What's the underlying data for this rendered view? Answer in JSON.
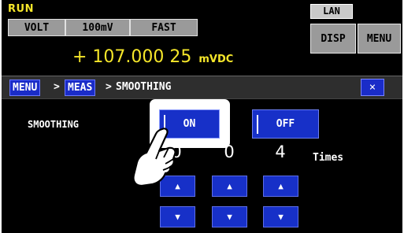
{
  "status": {
    "run": "RUN",
    "lan": "LAN"
  },
  "tabs": {
    "function": "VOLT",
    "range": "100mV",
    "speed": "FAST"
  },
  "side_buttons": {
    "disp": "DISP",
    "menu": "MENU"
  },
  "reading": {
    "value": "+ 107.000 25",
    "unit": "mVDC"
  },
  "breadcrumb": {
    "menu": "MENU",
    "meas": "MEAS",
    "page": "SMOOTHING",
    "sep": ">",
    "close": "×"
  },
  "smoothing": {
    "label": "SMOOTHING",
    "on_label": "ON",
    "off_label": "OFF",
    "selected": "ON",
    "digits": [
      "0",
      "0",
      "4"
    ],
    "unit": "Times"
  },
  "arrows": {
    "up": "▲",
    "down": "▼"
  },
  "icons": {
    "hand": "pointing-hand-icon",
    "close": "close-icon"
  },
  "colors": {
    "accent_yellow": "#f5e62a",
    "button_blue": "#1730c8",
    "gray": "#9a9a9a"
  }
}
